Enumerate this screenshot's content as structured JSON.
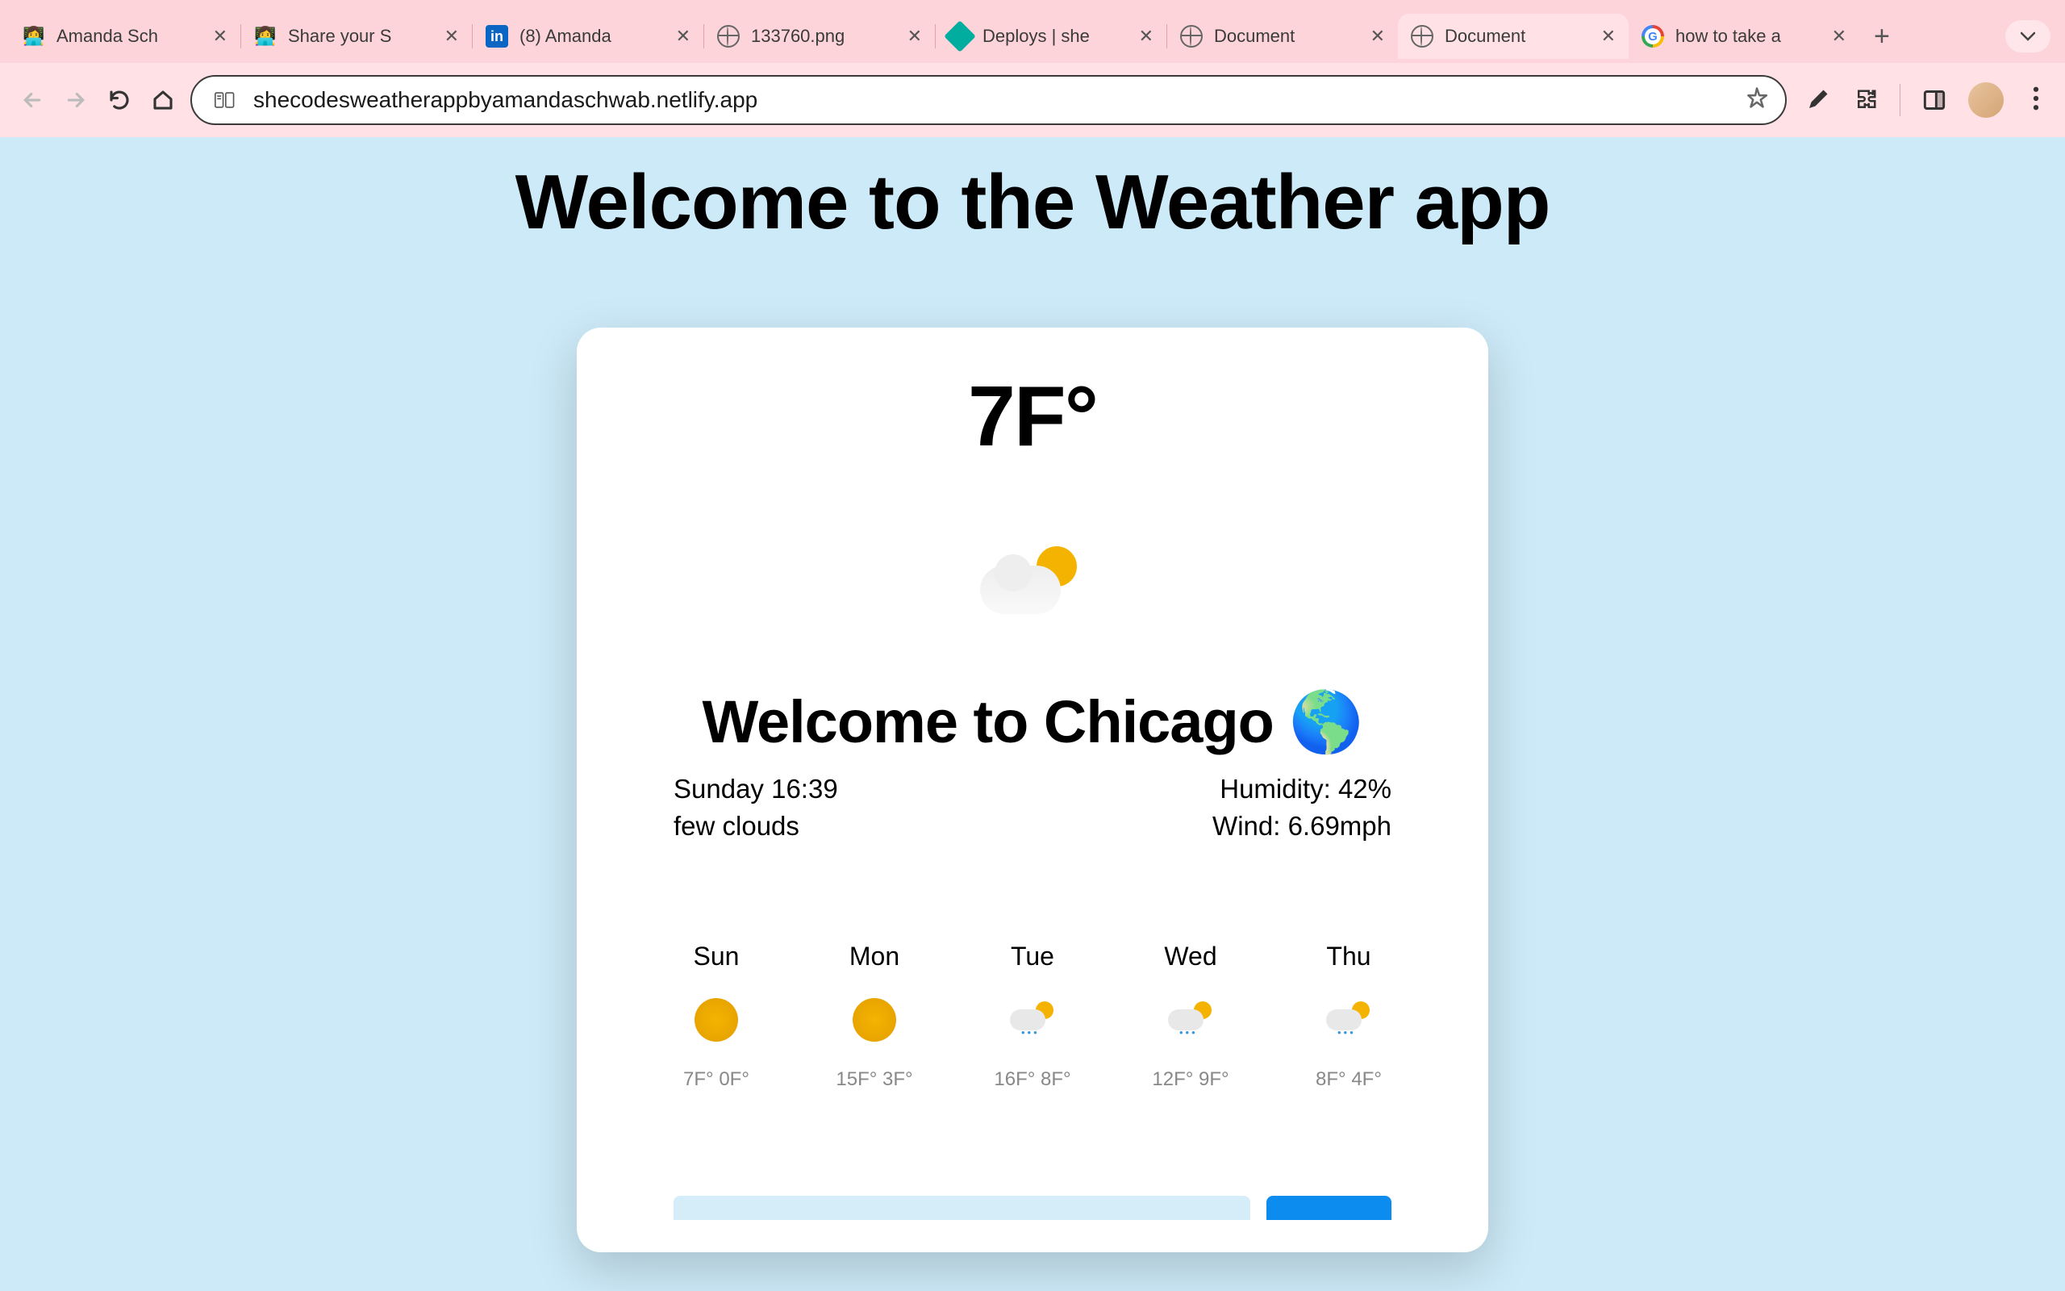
{
  "browser": {
    "tabs": [
      {
        "title": "Amanda Sch",
        "icon": "shecodes"
      },
      {
        "title": "Share your S",
        "icon": "shecodes"
      },
      {
        "title": "(8) Amanda",
        "icon": "linkedin"
      },
      {
        "title": "133760.png",
        "icon": "globe"
      },
      {
        "title": "Deploys | she",
        "icon": "netlify"
      },
      {
        "title": "Document",
        "icon": "globe"
      },
      {
        "title": "Document",
        "icon": "globe",
        "active": true
      },
      {
        "title": "how to take a",
        "icon": "google"
      }
    ],
    "url": "shecodesweatherappbyamandaschwab.netlify.app"
  },
  "page": {
    "title": "Welcome to the Weather app",
    "current_temp": "7F°",
    "city_heading": "Welcome to Chicago 🌎",
    "datetime": "Sunday 16:39",
    "condition": "few clouds",
    "humidity": "Humidity: 42%",
    "wind": "Wind: 6.69mph",
    "forecast": [
      {
        "day": "Sun",
        "icon": "sun",
        "temps": "7F° 0F°"
      },
      {
        "day": "Mon",
        "icon": "sun",
        "temps": "15F° 3F°"
      },
      {
        "day": "Tue",
        "icon": "rain",
        "temps": "16F° 8F°"
      },
      {
        "day": "Wed",
        "icon": "rain",
        "temps": "12F° 9F°"
      },
      {
        "day": "Thu",
        "icon": "rain",
        "temps": "8F° 4F°"
      }
    ]
  }
}
